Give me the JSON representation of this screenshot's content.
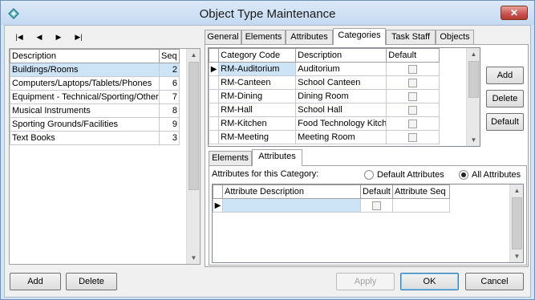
{
  "window": {
    "title": "Object Type Maintenance",
    "close_glyph": "✕"
  },
  "nav": {
    "first": "|◀",
    "prev": "◀",
    "next": "▶",
    "last": "▶|"
  },
  "types": {
    "columns": [
      "Description",
      "Seq"
    ],
    "rows": [
      {
        "description": "Buildings/Rooms",
        "seq": "2"
      },
      {
        "description": "Computers/Laptops/Tablets/Phones",
        "seq": "6"
      },
      {
        "description": "Equipment - Technical/Sporting/Other",
        "seq": "7"
      },
      {
        "description": "Musical Instruments",
        "seq": "8"
      },
      {
        "description": "Sporting Grounds/Facilities",
        "seq": "9"
      },
      {
        "description": "Text Books",
        "seq": "3"
      }
    ]
  },
  "main_tabs": [
    "General",
    "Elements",
    "Attributes",
    "Categories",
    "Task Staff",
    "Objects"
  ],
  "categories": {
    "columns": [
      "Category Code",
      "Description",
      "Default"
    ],
    "rows": [
      {
        "code": "RM-Auditorium",
        "description": "Auditorium"
      },
      {
        "code": "RM-Canteen",
        "description": "School Canteen"
      },
      {
        "code": "RM-Dining",
        "description": "Dining Room"
      },
      {
        "code": "RM-Hall",
        "description": "School Hall"
      },
      {
        "code": "RM-Kitchen",
        "description": "Food Technology Kitche"
      },
      {
        "code": "RM-Meeting",
        "description": "Meeting Room"
      }
    ]
  },
  "category_buttons": {
    "add": "Add",
    "delete": "Delete",
    "default": "Default"
  },
  "sub_tabs": [
    "Elements",
    "Attributes"
  ],
  "attributes": {
    "label": "Attributes for this Category:",
    "radio_default": "Default Attributes",
    "radio_all": "All Attributes",
    "columns": [
      "Attribute Description",
      "Default",
      "Attribute Seq"
    ]
  },
  "footer": {
    "add": "Add",
    "delete": "Delete",
    "apply": "Apply",
    "ok": "OK",
    "cancel": "Cancel"
  },
  "icons": {
    "up": "▲",
    "down": "▼",
    "row_pointer": "▶"
  }
}
